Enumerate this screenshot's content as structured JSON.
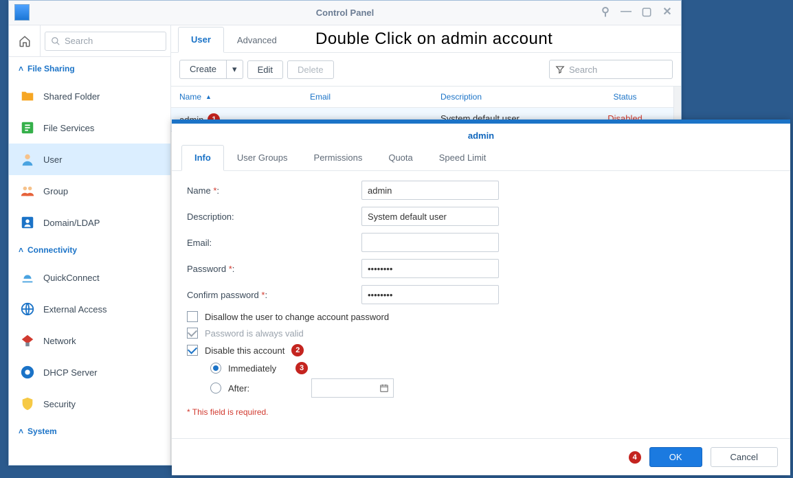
{
  "window": {
    "title": "Control Panel"
  },
  "headline": "Double Click on admin account",
  "sidebar": {
    "search_placeholder": "Search",
    "sections": [
      {
        "title": "File Sharing",
        "items": [
          {
            "label": "Shared Folder"
          },
          {
            "label": "File Services"
          },
          {
            "label": "User"
          },
          {
            "label": "Group"
          },
          {
            "label": "Domain/LDAP"
          }
        ]
      },
      {
        "title": "Connectivity",
        "items": [
          {
            "label": "QuickConnect"
          },
          {
            "label": "External Access"
          },
          {
            "label": "Network"
          },
          {
            "label": "DHCP Server"
          },
          {
            "label": "Security"
          }
        ]
      },
      {
        "title": "System",
        "items": []
      }
    ]
  },
  "main_tabs": {
    "user": "User",
    "advanced": "Advanced"
  },
  "toolbar": {
    "create": "Create",
    "edit": "Edit",
    "delete": "Delete",
    "search": "Search"
  },
  "grid": {
    "headers": {
      "name": "Name",
      "email": "Email",
      "description": "Description",
      "status": "Status"
    },
    "rows": [
      {
        "name": "admin",
        "email": "",
        "description": "System default user",
        "status": "Disabled"
      }
    ]
  },
  "badges": {
    "b1": "1",
    "b2": "2",
    "b3": "3",
    "b4": "4"
  },
  "dialog": {
    "title": "admin",
    "tabs": {
      "info": "Info",
      "groups": "User Groups",
      "permissions": "Permissions",
      "quota": "Quota",
      "speed": "Speed Limit"
    },
    "labels": {
      "name": "Name",
      "description": "Description:",
      "email": "Email:",
      "password": "Password",
      "confirm": "Confirm password",
      "disallow": "Disallow the user to change account password",
      "alwaysvalid": "Password is always valid",
      "disable": "Disable this account",
      "immediately": "Immediately",
      "after": "After:",
      "required_hint": "This field is required."
    },
    "values": {
      "name": "admin",
      "description": "System default user",
      "email": "",
      "password": "••••••••",
      "confirm": "••••••••"
    },
    "footer": {
      "ok": "OK",
      "cancel": "Cancel"
    }
  }
}
